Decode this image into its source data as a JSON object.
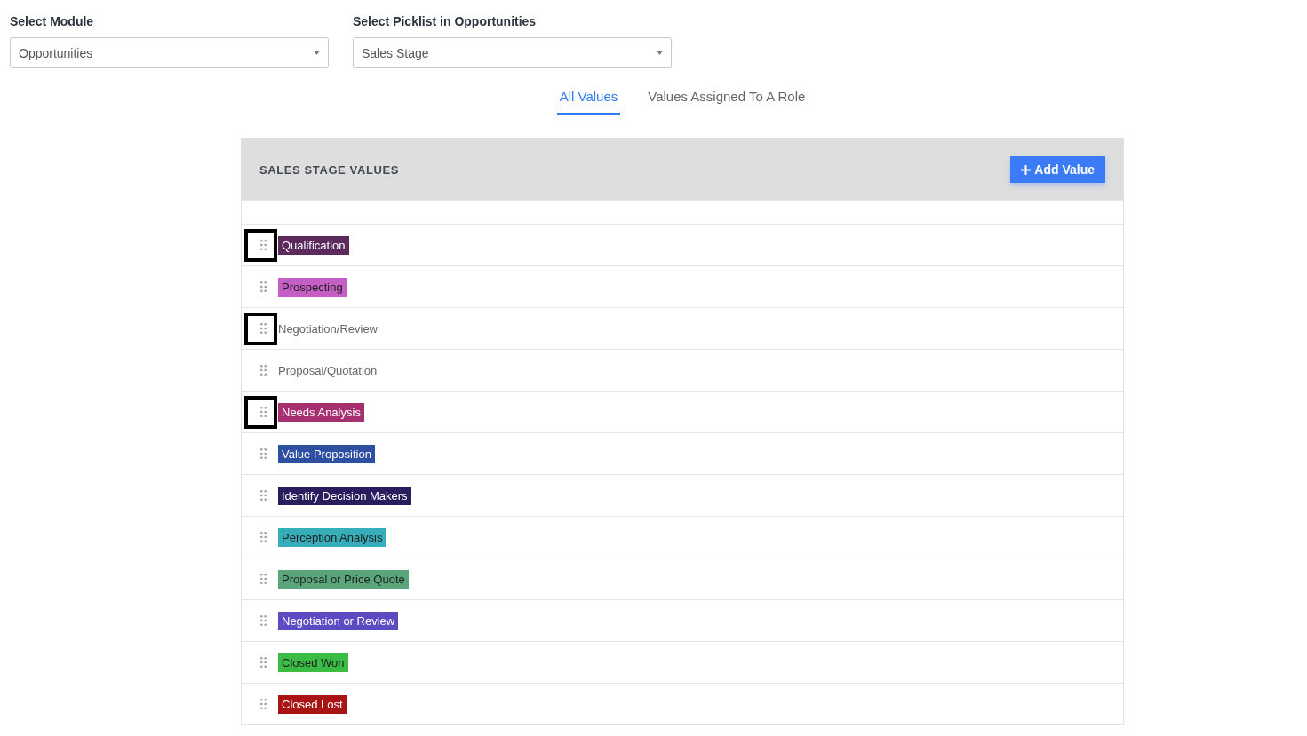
{
  "filters": [
    {
      "label": "Select Module",
      "value": "Opportunities"
    },
    {
      "label": "Select Picklist in Opportunities",
      "value": "Sales Stage"
    }
  ],
  "tabs": [
    {
      "label": "All Values",
      "selected": true
    },
    {
      "label": "Values Assigned To A Role",
      "selected": false
    }
  ],
  "panel": {
    "title": "SALES STAGE VALUES",
    "add_button": "Add Value",
    "values": [
      {
        "label": "Qualification",
        "color": "#5c2a5c",
        "highlighted": true
      },
      {
        "label": "Prospecting",
        "color": "#c55fc5",
        "highlighted": false
      },
      {
        "label": "Negotiation/Review",
        "highlighted": true
      },
      {
        "label": "Proposal/Quotation",
        "highlighted": false
      },
      {
        "label": "Needs Analysis",
        "color": "#a52f6f",
        "highlighted": true
      },
      {
        "label": "Value Proposition",
        "color": "#2f4fa3",
        "highlighted": false
      },
      {
        "label": "Identify Decision Makers",
        "color": "#2a1d5e",
        "highlighted": false
      },
      {
        "label": "Perception Analysis",
        "color": "#35aeb9",
        "highlighted": false
      },
      {
        "label": "Proposal or Price Quote",
        "color": "#5aa67a",
        "highlighted": false
      },
      {
        "label": "Negotiation or Review",
        "color": "#5b4cc4",
        "highlighted": false
      },
      {
        "label": "Closed Won",
        "color": "#3bbd45",
        "highlighted": false
      },
      {
        "label": "Closed Lost",
        "color": "#a81414",
        "highlighted": false
      }
    ]
  }
}
